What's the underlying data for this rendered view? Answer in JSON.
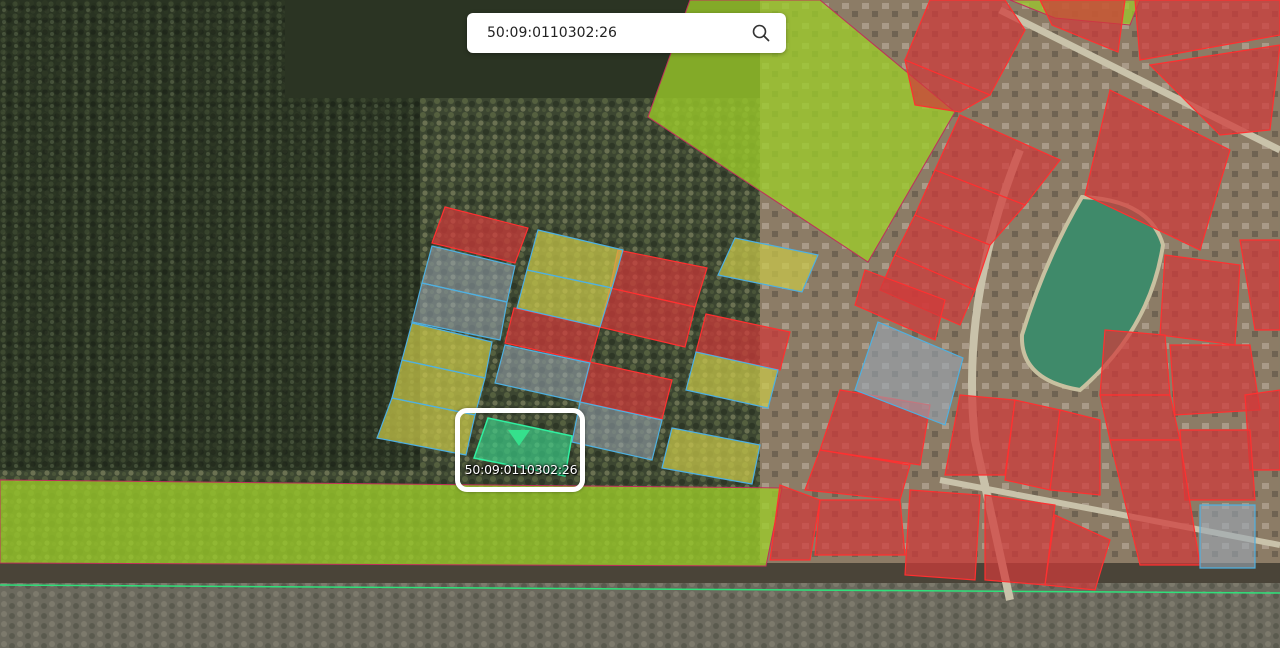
{
  "search": {
    "value": "50:09:0110302:26",
    "icon": "search-icon"
  },
  "selected_plot": {
    "label": "50:09:0110302:26",
    "marker_icon": "triangle-marker-icon"
  },
  "colors": {
    "red_parcel": "#d03a3a",
    "yellow_parcel": "#c9c84a",
    "grey_parcel": "#9aa7b4",
    "green_parcel": "#9ccc2a",
    "selected_parcel": "#3bd18a",
    "pond": "#3f8a6a"
  }
}
